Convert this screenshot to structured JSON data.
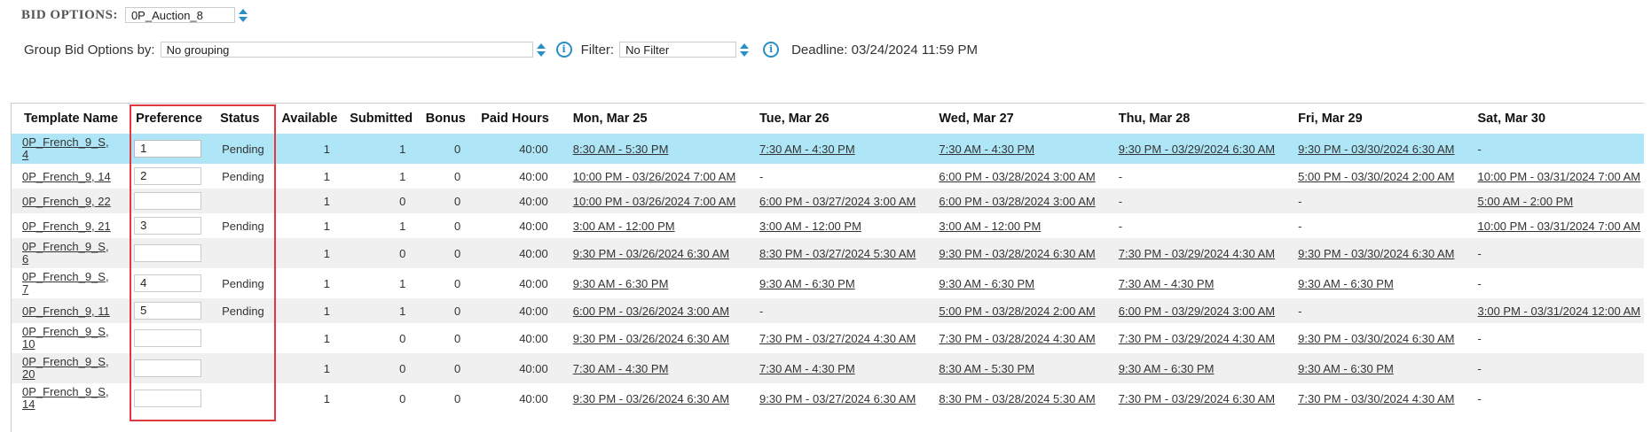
{
  "bid_options": {
    "label": "BID OPTIONS:",
    "value": "0P_Auction_8"
  },
  "group_by": {
    "label": "Group Bid Options by:",
    "value": "No grouping"
  },
  "filter": {
    "label": "Filter:",
    "value": "No Filter"
  },
  "info_icon_glyph": "i",
  "deadline": "Deadline: 03/24/2024 11:59 PM",
  "colors": {
    "accent": "#2a8fc7",
    "selected_row": "#aee6f8",
    "highlight": "#e0393e"
  },
  "table": {
    "headers": [
      "Template Name",
      "Preference",
      "Status",
      "Available",
      "Submitted",
      "Bonus",
      "Paid Hours",
      "Mon, Mar 25",
      "Tue, Mar 26",
      "Wed, Mar 27",
      "Thu, Mar 28",
      "Fri, Mar 29",
      "Sat, Mar 30"
    ],
    "rows": [
      {
        "name_l1": "0P_French_9_S,",
        "name_l2": "4",
        "pref": "1",
        "status": "Pending",
        "available": "1",
        "submitted": "1",
        "bonus": "0",
        "hours": "40:00",
        "mon": "8:30 AM - 5:30 PM",
        "tue": "7:30 AM - 4:30 PM",
        "wed": "7:30 AM - 4:30 PM",
        "thu": "9:30 PM - 03/29/2024 6:30 AM",
        "fri": "9:30 PM - 03/30/2024 6:30 AM",
        "sat": "-"
      },
      {
        "name_l1": "0P_French_9, 14",
        "name_l2": "",
        "pref": "2",
        "status": "Pending",
        "available": "1",
        "submitted": "1",
        "bonus": "0",
        "hours": "40:00",
        "mon": "10:00 PM - 03/26/2024 7:00 AM",
        "tue": "-",
        "wed": "6:00 PM - 03/28/2024 3:00 AM",
        "thu": "-",
        "fri": "5:00 PM - 03/30/2024 2:00 AM",
        "sat": "10:00 PM - 03/31/2024 7:00 AM"
      },
      {
        "name_l1": "0P_French_9, 22",
        "name_l2": "",
        "pref": "",
        "status": "",
        "available": "1",
        "submitted": "0",
        "bonus": "0",
        "hours": "40:00",
        "mon": "10:00 PM - 03/26/2024 7:00 AM",
        "tue": "6:00 PM - 03/27/2024 3:00 AM",
        "wed": "6:00 PM - 03/28/2024 3:00 AM",
        "thu": "-",
        "fri": "-",
        "sat": "5:00 AM - 2:00 PM"
      },
      {
        "name_l1": "0P_French_9, 21",
        "name_l2": "",
        "pref": "3",
        "status": "Pending",
        "available": "1",
        "submitted": "1",
        "bonus": "0",
        "hours": "40:00",
        "mon": "3:00 AM - 12:00 PM",
        "tue": "3:00 AM - 12:00 PM",
        "wed": "3:00 AM - 12:00 PM",
        "thu": "-",
        "fri": "-",
        "sat": "10:00 PM - 03/31/2024 7:00 AM"
      },
      {
        "name_l1": "0P_French_9_S,",
        "name_l2": "6",
        "pref": "",
        "status": "",
        "available": "1",
        "submitted": "0",
        "bonus": "0",
        "hours": "40:00",
        "mon": "9:30 PM - 03/26/2024 6:30 AM",
        "tue": "8:30 PM - 03/27/2024 5:30 AM",
        "wed": "9:30 PM - 03/28/2024 6:30 AM",
        "thu": "7:30 PM - 03/29/2024 4:30 AM",
        "fri": "9:30 PM - 03/30/2024 6:30 AM",
        "sat": "-"
      },
      {
        "name_l1": "0P_French_9_S,",
        "name_l2": "7",
        "pref": "4",
        "status": "Pending",
        "available": "1",
        "submitted": "1",
        "bonus": "0",
        "hours": "40:00",
        "mon": "9:30 AM - 6:30 PM",
        "tue": "9:30 AM - 6:30 PM",
        "wed": "9:30 AM - 6:30 PM",
        "thu": "7:30 AM - 4:30 PM",
        "fri": "9:30 AM - 6:30 PM",
        "sat": "-"
      },
      {
        "name_l1": "0P_French_9, 11",
        "name_l2": "",
        "pref": "5",
        "status": "Pending",
        "available": "1",
        "submitted": "1",
        "bonus": "0",
        "hours": "40:00",
        "mon": "6:00 PM - 03/26/2024 3:00 AM",
        "tue": "-",
        "wed": "5:00 PM - 03/28/2024 2:00 AM",
        "thu": "6:00 PM - 03/29/2024 3:00 AM",
        "fri": "-",
        "sat": "3:00 PM - 03/31/2024 12:00 AM"
      },
      {
        "name_l1": "0P_French_9_S,",
        "name_l2": "10",
        "pref": "",
        "status": "",
        "available": "1",
        "submitted": "0",
        "bonus": "0",
        "hours": "40:00",
        "mon": "9:30 PM - 03/26/2024 6:30 AM",
        "tue": "7:30 PM - 03/27/2024 4:30 AM",
        "wed": "7:30 PM - 03/28/2024 4:30 AM",
        "thu": "7:30 PM - 03/29/2024 4:30 AM",
        "fri": "9:30 PM - 03/30/2024 6:30 AM",
        "sat": "-"
      },
      {
        "name_l1": "0P_French_9_S,",
        "name_l2": "20",
        "pref": "",
        "status": "",
        "available": "1",
        "submitted": "0",
        "bonus": "0",
        "hours": "40:00",
        "mon": "7:30 AM - 4:30 PM",
        "tue": "7:30 AM - 4:30 PM",
        "wed": "8:30 AM - 5:30 PM",
        "thu": "9:30 AM - 6:30 PM",
        "fri": "9:30 AM - 6:30 PM",
        "sat": "-"
      },
      {
        "name_l1": "0P_French_9_S,",
        "name_l2": "14",
        "pref": "",
        "status": "",
        "available": "1",
        "submitted": "0",
        "bonus": "0",
        "hours": "40:00",
        "mon": "9:30 PM - 03/26/2024 6:30 AM",
        "tue": "9:30 PM - 03/27/2024 6:30 AM",
        "wed": "8:30 PM - 03/28/2024 5:30 AM",
        "thu": "7:30 PM - 03/29/2024 6:30 AM",
        "fri": "7:30 PM - 03/30/2024 4:30 AM",
        "sat": "-"
      }
    ]
  }
}
